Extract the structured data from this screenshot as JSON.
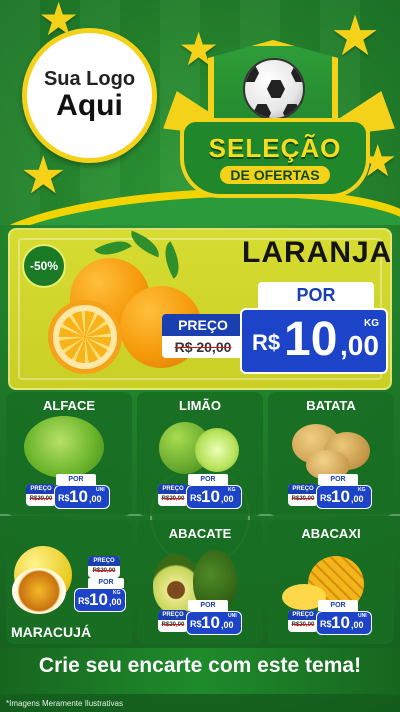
{
  "header": {
    "logo_line1": "Sua Logo",
    "logo_line2": "Aqui",
    "badge_title": "SELEÇÃO",
    "badge_subtitle": "DE OFERTAS"
  },
  "hero": {
    "discount": "-50%",
    "product": "LARANJA",
    "por_label": "POR",
    "preco_label": "PREÇO",
    "old_price": "R$ 20,00",
    "currency": "R$",
    "price_int": "10",
    "price_dec": ",00",
    "unit": "KG"
  },
  "products": [
    {
      "name": "ALFACE",
      "por_label": "POR",
      "preco_label": "PREÇO",
      "old_price": "R$20,00",
      "currency": "R$",
      "price_int": "10",
      "price_dec": ",00",
      "unit": "UNI"
    },
    {
      "name": "LIMÃO",
      "por_label": "POR",
      "preco_label": "PREÇO",
      "old_price": "R$20,00",
      "currency": "R$",
      "price_int": "10",
      "price_dec": ",00",
      "unit": "KG"
    },
    {
      "name": "BATATA",
      "por_label": "POR",
      "preco_label": "PREÇO",
      "old_price": "R$20,00",
      "currency": "R$",
      "price_int": "10",
      "price_dec": ",00",
      "unit": "KG"
    },
    {
      "name": "MARACUJÁ",
      "por_label": "POR",
      "preco_label": "PREÇO",
      "old_price": "R$20,00",
      "currency": "R$",
      "price_int": "10",
      "price_dec": ",00",
      "unit": "KG"
    },
    {
      "name": "ABACATE",
      "por_label": "POR",
      "preco_label": "PREÇO",
      "old_price": "R$20,00",
      "currency": "R$",
      "price_int": "10",
      "price_dec": ",00",
      "unit": "UNI"
    },
    {
      "name": "ABACAXI",
      "por_label": "POR",
      "preco_label": "PREÇO",
      "old_price": "R$20,00",
      "currency": "R$",
      "price_int": "10",
      "price_dec": ",00",
      "unit": "UNI"
    }
  ],
  "footer": {
    "cta": "Crie seu encarte com este tema!",
    "disclaimer": "*Imagens Meramente Ilustrativas"
  },
  "colors": {
    "green": "#1f7a2a",
    "yellow": "#f4d21a",
    "blue": "#1d44c8",
    "hero_bg": "#d7dc32"
  },
  "icons": [
    "star-icon",
    "soccer-ball-icon",
    "horn-icon"
  ]
}
